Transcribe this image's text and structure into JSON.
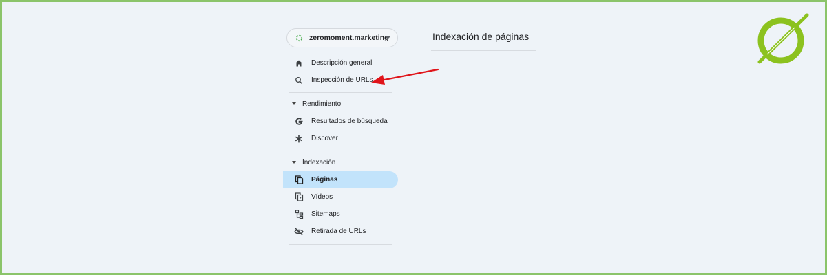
{
  "property": {
    "name": "zeromoment.marketing"
  },
  "main": {
    "title": "Indexación de páginas"
  },
  "nav": {
    "overview": "Descripción general",
    "url_inspection": "Inspección de URLs",
    "performance_section": "Rendimiento",
    "search_results": "Resultados de búsqueda",
    "discover": "Discover",
    "indexing_section": "Indexación",
    "pages": "Páginas",
    "videos": "Vídeos",
    "sitemaps": "Sitemaps",
    "removals": "Retirada de URLs"
  },
  "colors": {
    "accent_active": "#c2e3fb",
    "annotation_arrow": "#e0141a",
    "logo_green": "#8cc21f",
    "frame": "#8bc46a"
  }
}
